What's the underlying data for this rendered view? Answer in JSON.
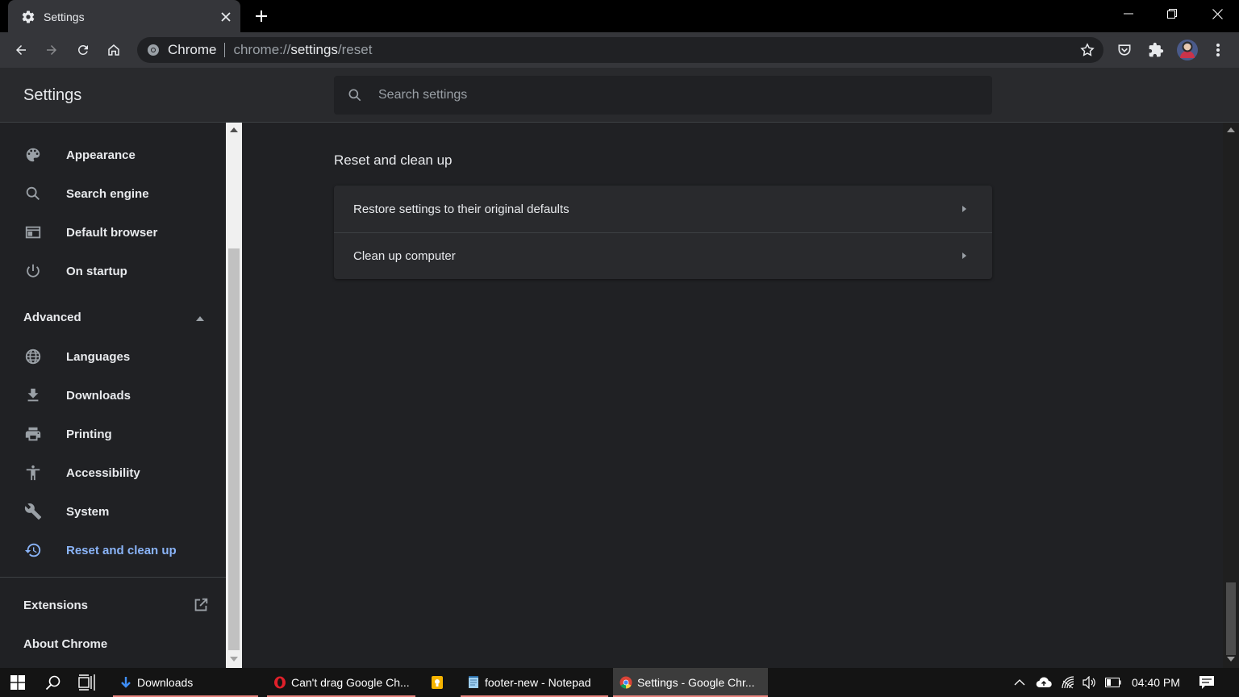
{
  "tab": {
    "title": "Settings"
  },
  "toolbar": {
    "site_name": "Chrome",
    "url_scheme": "chrome://",
    "url_host": "settings",
    "url_path": "/reset"
  },
  "header": {
    "title": "Settings",
    "search_placeholder": "Search settings"
  },
  "sidebar": {
    "items": [
      {
        "label": "Appearance",
        "icon": "palette-icon"
      },
      {
        "label": "Search engine",
        "icon": "search-icon"
      },
      {
        "label": "Default browser",
        "icon": "browser-window-icon"
      },
      {
        "label": "On startup",
        "icon": "power-icon"
      }
    ],
    "advanced_label": "Advanced",
    "advanced_items": [
      {
        "label": "Languages",
        "icon": "globe-icon"
      },
      {
        "label": "Downloads",
        "icon": "download-icon"
      },
      {
        "label": "Printing",
        "icon": "printer-icon"
      },
      {
        "label": "Accessibility",
        "icon": "accessibility-icon"
      },
      {
        "label": "System",
        "icon": "wrench-icon"
      },
      {
        "label": "Reset and clean up",
        "icon": "history-icon",
        "active": true
      }
    ],
    "extensions_label": "Extensions",
    "about_label": "About Chrome"
  },
  "main": {
    "section_title": "Reset and clean up",
    "rows": [
      {
        "label": "Restore settings to their original defaults"
      },
      {
        "label": "Clean up computer"
      }
    ]
  },
  "taskbar": {
    "apps": [
      {
        "label": "Downloads",
        "icon": "download-arrow-icon"
      },
      {
        "label": "Can't drag Google Ch...",
        "icon": "opera-icon"
      },
      {
        "label": "footer-new - Notepad",
        "icon": "notepad-icon"
      },
      {
        "label": "Settings - Google Chr...",
        "icon": "chrome-icon",
        "active": true
      }
    ],
    "clock": "04:40 PM"
  },
  "colors": {
    "accent": "#8ab4f8",
    "background": "#202124",
    "card": "#292a2d",
    "toolbar": "#35363a"
  }
}
